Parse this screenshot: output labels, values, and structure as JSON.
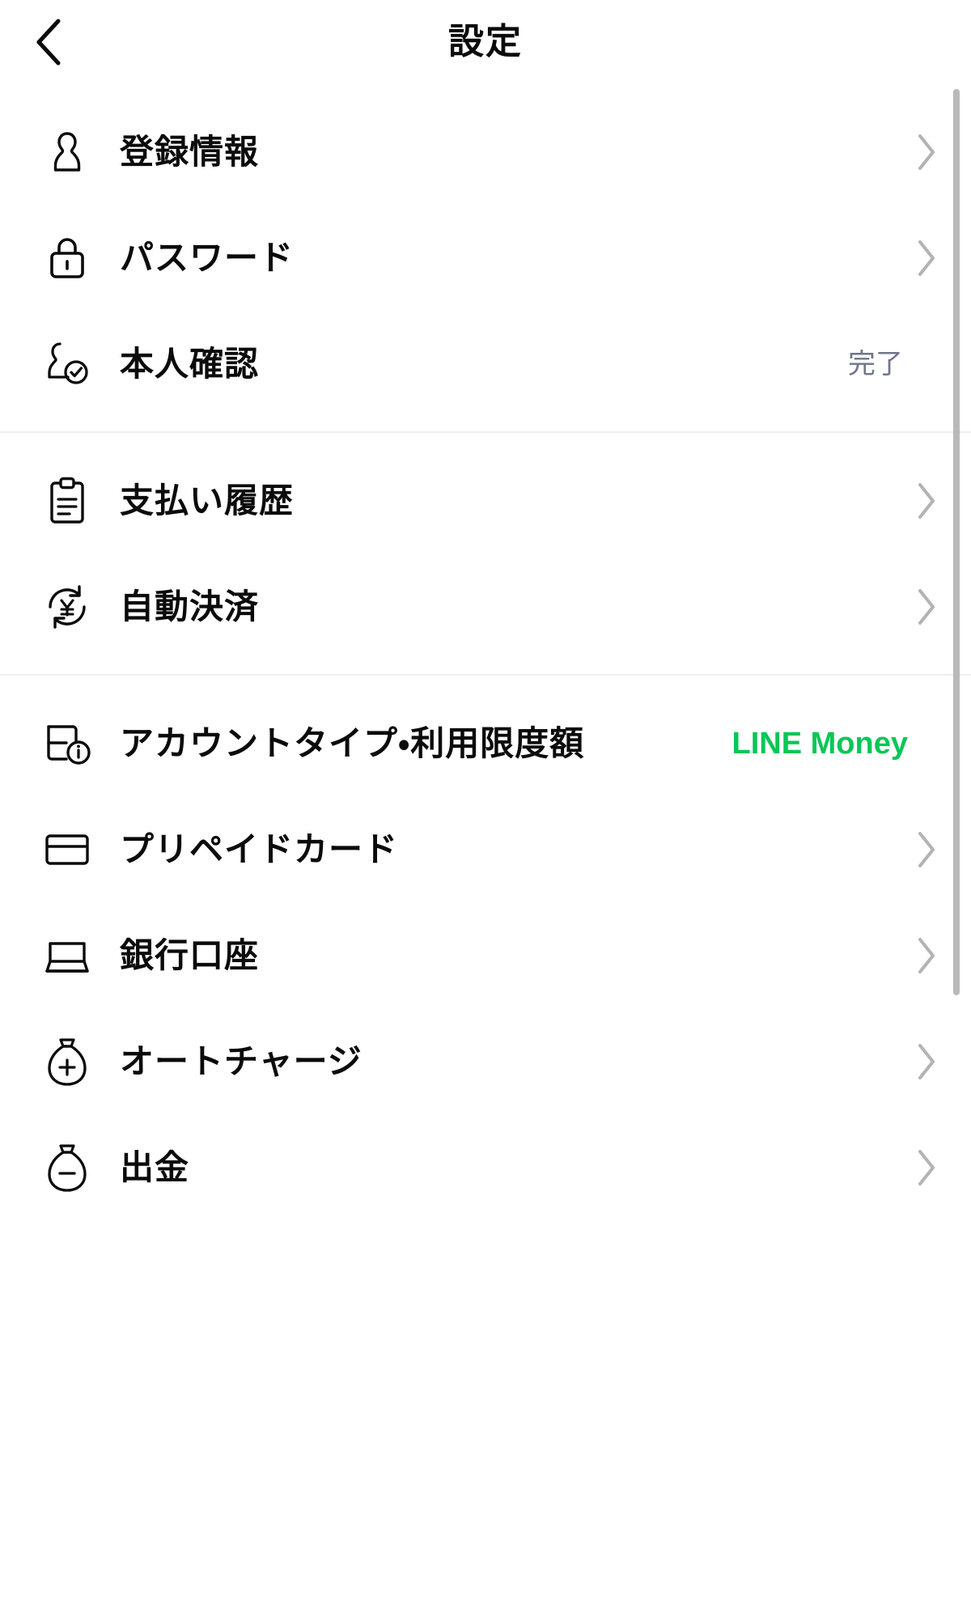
{
  "header": {
    "title": "設定",
    "back_icon": "chevron-left-icon"
  },
  "chevron_icon": "chevron-right-icon",
  "groups": [
    {
      "id": "account-group",
      "rows": [
        {
          "id": "registration-info",
          "icon": "person-icon",
          "label": "登録情報",
          "value": "",
          "value_style": "",
          "has_chevron": true
        },
        {
          "id": "password",
          "icon": "lock-icon",
          "label": "パスワード",
          "value": "",
          "value_style": "",
          "has_chevron": true
        },
        {
          "id": "identity-verification",
          "icon": "person-check-icon",
          "label": "本人確認",
          "value": "完了",
          "value_style": "muted",
          "has_chevron": false
        }
      ]
    },
    {
      "id": "payment-group",
      "rows": [
        {
          "id": "payment-history",
          "icon": "clipboard-icon",
          "label": "支払い履歴",
          "value": "",
          "value_style": "",
          "has_chevron": true
        },
        {
          "id": "auto-payment",
          "icon": "yen-refresh-icon",
          "label": "自動決済",
          "value": "",
          "value_style": "",
          "has_chevron": true
        }
      ]
    },
    {
      "id": "money-group",
      "rows": [
        {
          "id": "account-type-limit",
          "icon": "account-info-icon",
          "label": "アカウントタイプ・利用限度額",
          "value": "LINE Money",
          "value_style": "accent",
          "has_chevron": false
        },
        {
          "id": "prepaid-card",
          "icon": "credit-card-icon",
          "label": "プリペイドカード",
          "value": "",
          "value_style": "",
          "has_chevron": true
        },
        {
          "id": "bank-account",
          "icon": "bank-icon",
          "label": "銀行口座",
          "value": "",
          "value_style": "",
          "has_chevron": true
        },
        {
          "id": "auto-charge",
          "icon": "money-bag-plus-icon",
          "label": "オートチャージ",
          "value": "",
          "value_style": "",
          "has_chevron": true
        },
        {
          "id": "withdrawal",
          "icon": "money-bag-minus-icon",
          "label": "出金",
          "value": "",
          "value_style": "",
          "has_chevron": true
        }
      ]
    }
  ],
  "colors": {
    "accent_green": "#06C755",
    "text_primary": "#0B0B0B",
    "text_muted": "#6F7589",
    "chevron": "#B3B3B3",
    "divider": "#EFEFF1",
    "scrollbar": "#B9B9B9",
    "background": "#FFFFFF"
  },
  "scrollbar": {
    "name": "vertical-scrollbar"
  }
}
